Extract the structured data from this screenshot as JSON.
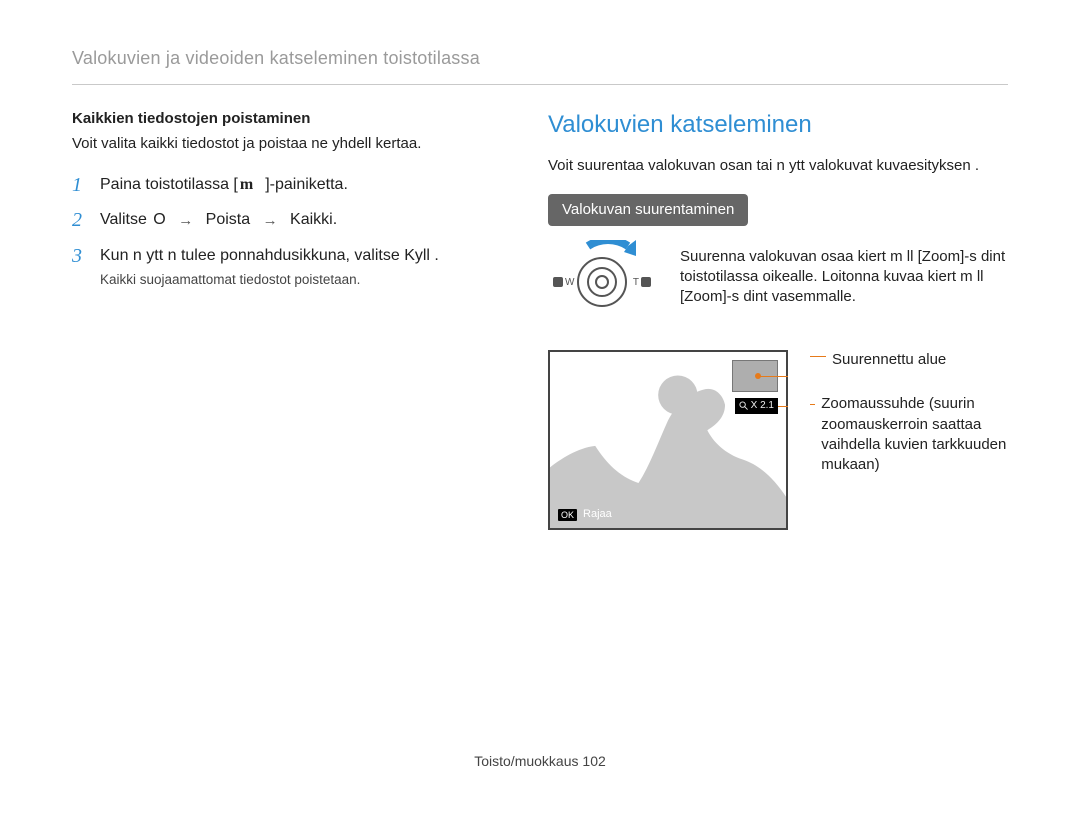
{
  "header": {
    "title": "Valokuvien ja videoiden katseleminen toistotilassa"
  },
  "left": {
    "subhead": "Kaikkien tiedostojen poistaminen",
    "lead": "Voit valita kaikki tiedostot ja poistaa ne yhdell  kertaa.",
    "steps": [
      {
        "num": "1",
        "pre": "Paina toistotilassa [",
        "key": "m",
        "post": "]-painiketta."
      },
      {
        "num": "2",
        "text": "Valitse",
        "path1": "O",
        "path2": "Poista",
        "path3": "Kaikki."
      },
      {
        "num": "3",
        "text": "Kun n ytt n tulee ponnahdusikkuna, valitse Kyll .",
        "note": "Kaikki suojaamattomat tiedostot poistetaan."
      }
    ]
  },
  "right": {
    "title": "Valokuvien katseleminen",
    "lead": "Voit suurentaa valokuvan osan tai n ytt   valokuvat kuvaesityksen .",
    "pill": "Valokuvan suurentaminen",
    "zoom_text": "Suurenna valokuvan osaa kiert m ll  [Zoom]-s  dint  toistotilassa oikealle. Loitonna kuvaa kiert m ll  [Zoom]-s  dint  vasemmalle.",
    "zoom_wt": {
      "w": "W",
      "t": "T"
    },
    "lcd": {
      "zoom_label": "X 2.1",
      "crop_ok": "OK",
      "crop_label": "Rajaa"
    },
    "callouts": {
      "mini": "Suurennettu alue",
      "ratio": "Zoomaussuhde (suurin zoomauskerroin saattaa vaihdella kuvien tarkkuuden mukaan)"
    }
  },
  "footer": {
    "section": "Toisto/muokkaus",
    "page": "102"
  }
}
